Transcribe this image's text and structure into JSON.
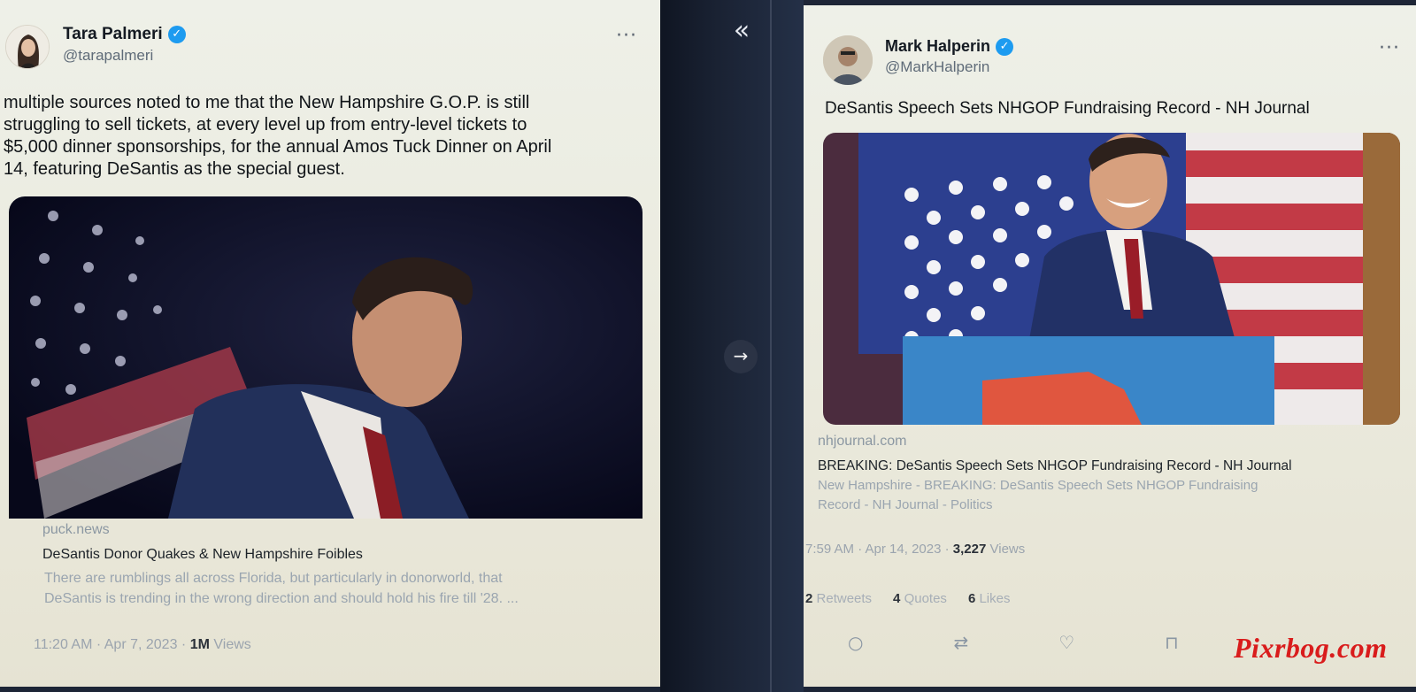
{
  "ui": {
    "collapse_icon": "«",
    "open_icon": "→",
    "more_icon": "···",
    "verified_icon": "✓"
  },
  "tweet_left": {
    "author_name": "Tara Palmeri",
    "handle": "@tarapalmeri",
    "text_lines": [
      "multiple sources noted to me that the New Hampshire G.O.P. is still",
      "struggling to sell tickets, at every level up from entry-level tickets to",
      "$5,000 dinner sponsorships, for the annual Amos Tuck Dinner on April",
      "14, featuring DeSantis as the special guest."
    ],
    "link_card": {
      "domain": "puck.news",
      "title": "DeSantis Donor Quakes & New Hampshire Foibles",
      "description_lines": [
        "There are rumblings all across Florida, but particularly in donorworld, that",
        "DeSantis is trending in the wrong direction and should hold his fire till '28. ..."
      ]
    },
    "timestamp": "11:20 AM · Apr 7, 2023 ·",
    "views_count": "1M",
    "views_label": "Views"
  },
  "tweet_right": {
    "author_name": "Mark Halperin",
    "handle": "@MarkHalperin",
    "text": "DeSantis Speech Sets NHGOP Fundraising Record - NH Journal",
    "link_card": {
      "domain": "nhjournal.com",
      "title": "BREAKING: DeSantis Speech Sets NHGOP Fundraising Record - NH Journal",
      "description_lines": [
        "New Hampshire - BREAKING: DeSantis Speech Sets NHGOP Fundraising",
        "Record - NH Journal - Politics"
      ]
    },
    "timestamp": "7:59 AM · Apr 14, 2023 ·",
    "views_count": "3,227",
    "views_label": "Views",
    "engagement": {
      "retweets_count": "2",
      "retweets_label": "Retweets",
      "quotes_count": "4",
      "quotes_label": "Quotes",
      "likes_count": "6",
      "likes_label": "Likes"
    },
    "actions": {
      "reply_icon": "○",
      "retweet_icon": "⇄",
      "like_icon": "♡",
      "bookmark_icon": "⊓"
    }
  },
  "watermark": "Pixrbog.com",
  "colors": {
    "verified": "#1d9bf0",
    "watermark": "#d91c1c",
    "flag_red": "#b5213a",
    "flag_blue": "#2c3f8f"
  }
}
